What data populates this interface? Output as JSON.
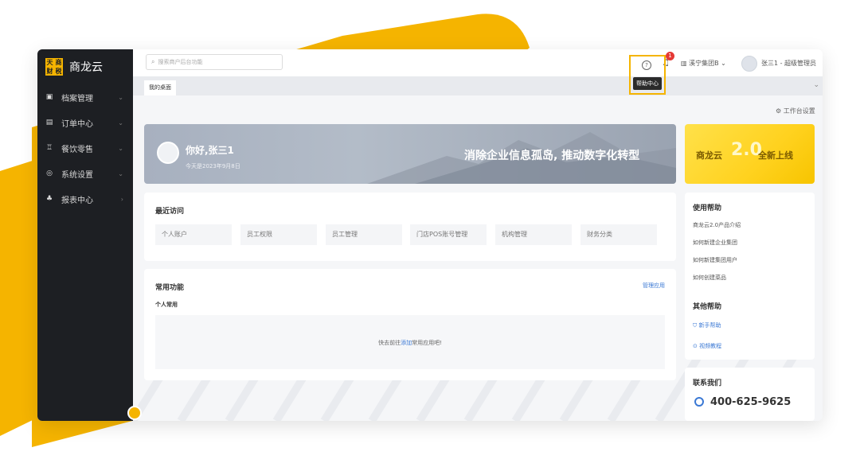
{
  "colors": {
    "accent": "#f5b400",
    "sidebar": "#1d1f23",
    "link": "#3a78d4",
    "badge": "#e53935"
  },
  "logo": {
    "mark": [
      "天",
      "商",
      "财",
      "税"
    ],
    "name": "商龙云"
  },
  "sidebar": {
    "items": [
      {
        "label": "档案管理",
        "icon": "archive-icon",
        "glyph": "▣",
        "arrow": "⌄"
      },
      {
        "label": "订单中心",
        "icon": "order-icon",
        "glyph": "▤",
        "arrow": "⌄"
      },
      {
        "label": "餐饮零售",
        "icon": "store-icon",
        "glyph": "♖",
        "arrow": "⌄"
      },
      {
        "label": "系统设置",
        "icon": "settings-icon",
        "glyph": "◎",
        "arrow": "⌄"
      },
      {
        "label": "报表中心",
        "icon": "report-icon",
        "glyph": "♣",
        "arrow": "›"
      }
    ]
  },
  "topbar": {
    "search_placeholder": "搜索商户后台功能",
    "help_tooltip": "帮助中心",
    "notification_count": "1",
    "org": "溪宁集团B",
    "user": "张三1 - 超级管理员"
  },
  "tabs": {
    "active": "我的桌面"
  },
  "workbench_settings": "工作台设置",
  "banner": {
    "greeting": "你好,张三1",
    "date": "今天是2023年9月8日",
    "slogan": "消除企业信息孤岛, 推动数字化转型"
  },
  "promo": {
    "brand": "商龙云",
    "version": "2.0",
    "tagline": "全新上线"
  },
  "recent": {
    "title": "最近访问",
    "items": [
      "个人账户",
      "员工权限",
      "员工管理",
      "门店POS账号管理",
      "机构管理",
      "财务分类"
    ]
  },
  "common": {
    "title": "常用功能",
    "manage": "管理应用",
    "subtitle": "个人常用",
    "empty_prefix": "快去前往",
    "empty_link": "添加",
    "empty_suffix": "常用应用吧!"
  },
  "help": {
    "title": "使用帮助",
    "items": [
      "商龙云2.0产品介绍",
      "如何新建企业集团",
      "如何新建集团用户",
      "如何创建菜品"
    ],
    "other_title": "其他帮助",
    "other_items": [
      "新手帮助",
      "视频教程"
    ]
  },
  "contact": {
    "title": "联系我们",
    "phone": "400-625-9625"
  }
}
